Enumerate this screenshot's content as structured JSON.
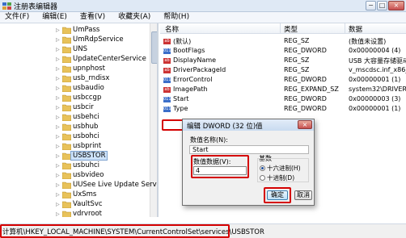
{
  "window": {
    "title": "注册表编辑器",
    "minimize": "−",
    "maximize": "□",
    "close": "×"
  },
  "menu": [
    "文件(F)",
    "编辑(E)",
    "查看(V)",
    "收藏夹(A)",
    "帮助(H)"
  ],
  "tree": {
    "items": [
      "UmPass",
      "UmRdpService",
      "UNS",
      "UpdateCenterService",
      "upnphost",
      "usb_rndisx",
      "usbaudio",
      "usbccgp",
      "usbcir",
      "usbehci",
      "usbhub",
      "usbohci",
      "usbprint",
      "USBSTOR",
      "usbuhci",
      "usbvideo",
      "UUSee Live Update Service",
      "UxSms",
      "VaultSvc",
      "vdrvroot"
    ],
    "selected": "USBSTOR"
  },
  "values": {
    "headers": {
      "name": "名称",
      "type": "类型",
      "data": "数据"
    },
    "rows": [
      {
        "icon": "ab",
        "name": "(默认)",
        "type": "REG_SZ",
        "data": "(数值未设置)"
      },
      {
        "icon": "bin",
        "name": "BootFlags",
        "type": "REG_DWORD",
        "data": "0x00000004 (4)"
      },
      {
        "icon": "ab",
        "name": "DisplayName",
        "type": "REG_SZ",
        "data": "USB 大容量存储驱动程"
      },
      {
        "icon": "ab",
        "name": "DriverPackageId",
        "type": "REG_SZ",
        "data": "v_mscdsc.inf_x86_neutr"
      },
      {
        "icon": "bin",
        "name": "ErrorControl",
        "type": "REG_DWORD",
        "data": "0x00000001 (1)"
      },
      {
        "icon": "ab",
        "name": "ImagePath",
        "type": "REG_EXPAND_SZ",
        "data": "system32\\DRIVERS\\US"
      },
      {
        "icon": "bin",
        "name": "Start",
        "type": "REG_DWORD",
        "data": "0x00000003 (3)"
      },
      {
        "icon": "bin",
        "name": "Type",
        "type": "REG_DWORD",
        "data": "0x00000001 (1)"
      }
    ]
  },
  "dialog": {
    "title": "编辑 DWORD (32 位)值",
    "close": "×",
    "name_label": "数值名称(N):",
    "name_value": "Start",
    "data_label": "数值数据(V):",
    "data_value": "4",
    "base_label": "基数",
    "radio_hex": "十六进制(H)",
    "radio_dec": "十进制(D)",
    "base_selected": "hex",
    "ok": "确定",
    "cancel": "取消"
  },
  "status": {
    "path": "计算机\\HKEY_LOCAL_MACHINE\\SYSTEM\\CurrentControlSet\\services\\USBSTOR"
  },
  "colors": {
    "highlight": "#d40000",
    "selection": "#cde3fb",
    "folder": "#e8c25a"
  }
}
